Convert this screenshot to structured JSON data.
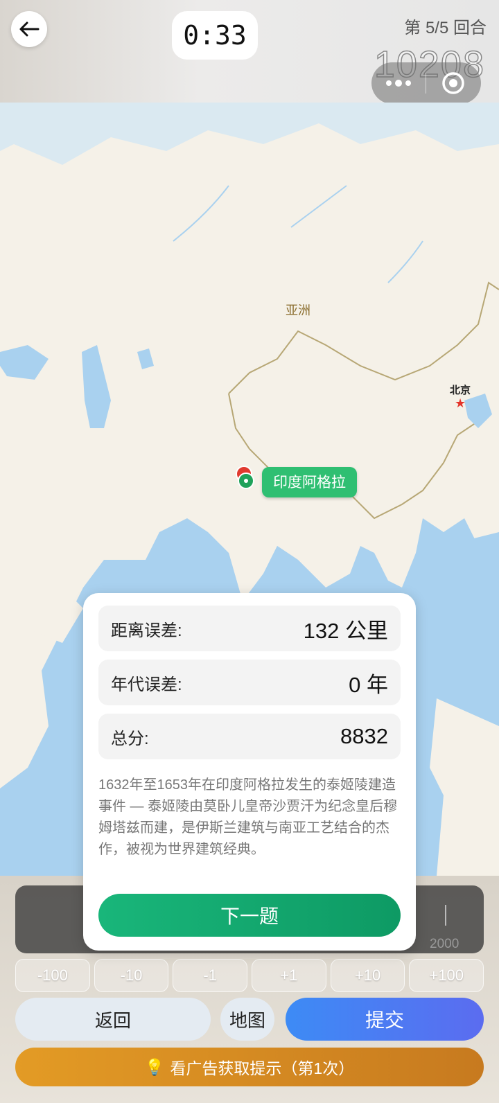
{
  "header": {
    "timer": "0:33",
    "round": "第 5/5 回合",
    "score": "10208"
  },
  "map": {
    "region_label": "亚洲",
    "city_label": "北京",
    "city_marker": "★",
    "place_tag": "印度阿格拉",
    "colors": {
      "land": "#f5f1e8",
      "water": "#a9d1ef",
      "guess_pin": "#e03a2f",
      "answer_pin": "#1fa25a"
    }
  },
  "result": {
    "distance_label": "距离误差:",
    "distance_value": "132 公里",
    "year_label": "年代误差:",
    "year_value": "0 年",
    "total_label": "总分:",
    "total_value": "8832",
    "description": "1632年至1653年在印度阿格拉发生的泰姬陵建造事件 — 泰姬陵由莫卧儿皇帝沙贾汗为纪念皇后穆姆塔兹而建，是伊斯兰建筑与南亚工艺结合的杰作，被视为世界建筑经典。",
    "next_button": "下一题"
  },
  "year_picker": {
    "end_label": "2000",
    "steps": [
      "-100",
      "-10",
      "-1",
      "+1",
      "+10",
      "+100"
    ]
  },
  "actions": {
    "return_label": "返回",
    "map_label": "地图",
    "submit_label": "提交",
    "ad_label": "看广告获取提示（第1次）",
    "ad_icon": "💡"
  },
  "icons": {
    "back": "back-arrow-icon",
    "more": "more-dots-icon",
    "record": "record-icon",
    "pin": "map-pin-icon"
  }
}
